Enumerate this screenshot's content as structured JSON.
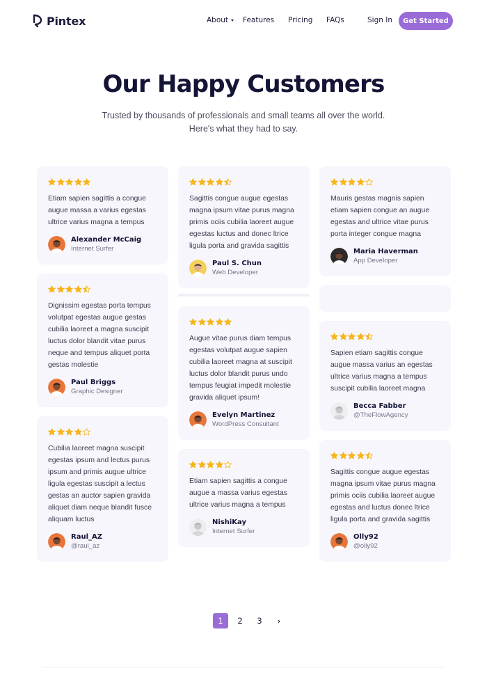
{
  "brand": {
    "name": "Pintex",
    "accent": "#9a6cd8",
    "star_color": "#f6b51b"
  },
  "nav": {
    "about": "About",
    "features": "Features",
    "pricing": "Pricing",
    "faqs": "FAQs",
    "sign_in": "Sign In",
    "cta": "Get Started"
  },
  "hero": {
    "title": "Our Happy Customers",
    "subtitle_line1": "Trusted by thousands of professionals and small teams all over the world.",
    "subtitle_line2": "Here's what they had to say."
  },
  "columns": [
    [
      {
        "rating": 5,
        "text": "Etiam sapien sagittis a congue augue massa a varius egestas ultrice varius magna a tempus",
        "name": "Alexander McCaig",
        "role": "Internet Surfer",
        "avatar": "avatar-orange"
      },
      {
        "rating": 4.5,
        "text": "Dignissim egestas porta tempus volutpat egestas augue gestas cubilia laoreet a magna suscipit luctus dolor blandit vitae purus neque and tempus aliquet porta gestas molestie",
        "name": "Paul Briggs",
        "role": "Graphic Designer",
        "avatar": "avatar-orange"
      },
      {
        "rating": 4,
        "text": "Cubilia laoreet magna suscipit egestas ipsum and lectus purus ipsum and primis augue ultrice ligula egestas suscipit a lectus gestas an auctor sapien gravida aliquet diam neque blandit fusce aliquam luctus",
        "name": "Raul_AZ",
        "role": "@raul_az",
        "avatar": "avatar-orange"
      }
    ],
    [
      {
        "rating": 4.5,
        "text": "Sagittis congue augue egestas magna ipsum vitae purus magna primis ociis cubilia laoreet augue egestas luctus and donec ltrice ligula porta and gravida sagittis",
        "name": "Paul S. Chun",
        "role": "Web Developer",
        "avatar": "avatar-yellow"
      },
      {
        "rating": 5,
        "text": "Augue vitae purus diam tempus egestas volutpat augue sapien cubilia laoreet magna at suscipit luctus dolor blandit purus undo tempus feugiat impedit molestie gravida aliquet ipsum!",
        "name": "Evelyn Martinez",
        "role": "WordPress Consultant",
        "avatar": "avatar-orange"
      },
      {
        "rating": 4,
        "text": "Etiam sapien sagittis a congue augue a massa varius egestas ultrice varius magna a tempus",
        "name": "NishiKay",
        "role": "Internet Surfer",
        "avatar": "avatar-default"
      }
    ],
    [
      {
        "rating": 4,
        "text": "Mauris gestas magnis sapien etiam sapien congue an augue egestas and ultrice vitae purus porta integer congue magna",
        "name": "Maria Haverman",
        "role": "App Developer",
        "avatar": "avatar-dark"
      },
      {
        "rating": 4.5,
        "text": "Sapien etiam sagittis congue augue massa varius an egestas ultrice varius magna a tempus suscipit cubilia laoreet magna",
        "name": "Becca Fabber",
        "role": "@TheFlowAgency",
        "avatar": "avatar-default"
      },
      {
        "rating": 4.5,
        "text": "Sagittis congue augue egestas magna ipsum vitae purus magna primis ociis cubilia laoreet augue egestas and luctus donec ltrice ligula porta and gravida sagittis",
        "name": "Olly92",
        "role": "@olly92",
        "avatar": "avatar-orange"
      }
    ]
  ],
  "pagination": {
    "pages": [
      "1",
      "2",
      "3"
    ],
    "current": "1",
    "next": "›"
  }
}
